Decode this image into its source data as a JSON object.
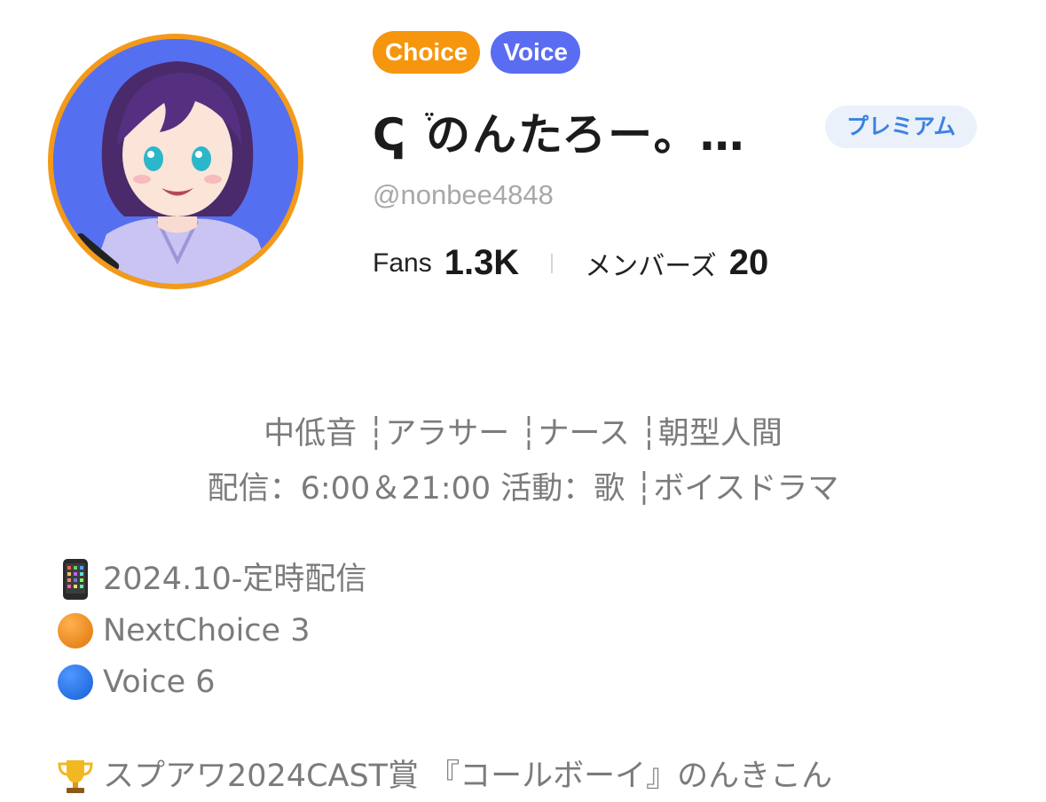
{
  "profile": {
    "tags": [
      "Choice",
      "Voice"
    ],
    "display_name": "ↅ ֒のんたろー。…",
    "badge": "プレミアム",
    "handle": "@nonbee4848",
    "stats": {
      "fans_label": "Fans",
      "fans_value": "1.3K",
      "members_label": "メンバーズ",
      "members_value": "20"
    }
  },
  "bio": {
    "line1": "中低音 ┆アラサー ┆ナース ┆朝型人間",
    "line2": "配信：6:00＆21:00  活動：歌 ┆ボイスドラマ",
    "items": [
      {
        "icon": "smartphone-icon",
        "text": "2024.10-定時配信"
      },
      {
        "icon": "orange-circle-icon",
        "text": "NextChoice 3"
      },
      {
        "icon": "blue-circle-icon",
        "text": "Voice 6"
      }
    ],
    "award": {
      "icon": "trophy-icon",
      "text": "スプアワ2024CAST賞 『コールボーイ』のんきこん"
    }
  },
  "colors": {
    "avatar_ring": "#f39a1a",
    "choice_tag": "#f5960e",
    "voice_tag": "#5a6cf2",
    "premium_bg": "#eaf1fb",
    "premium_text": "#3b82e0"
  }
}
